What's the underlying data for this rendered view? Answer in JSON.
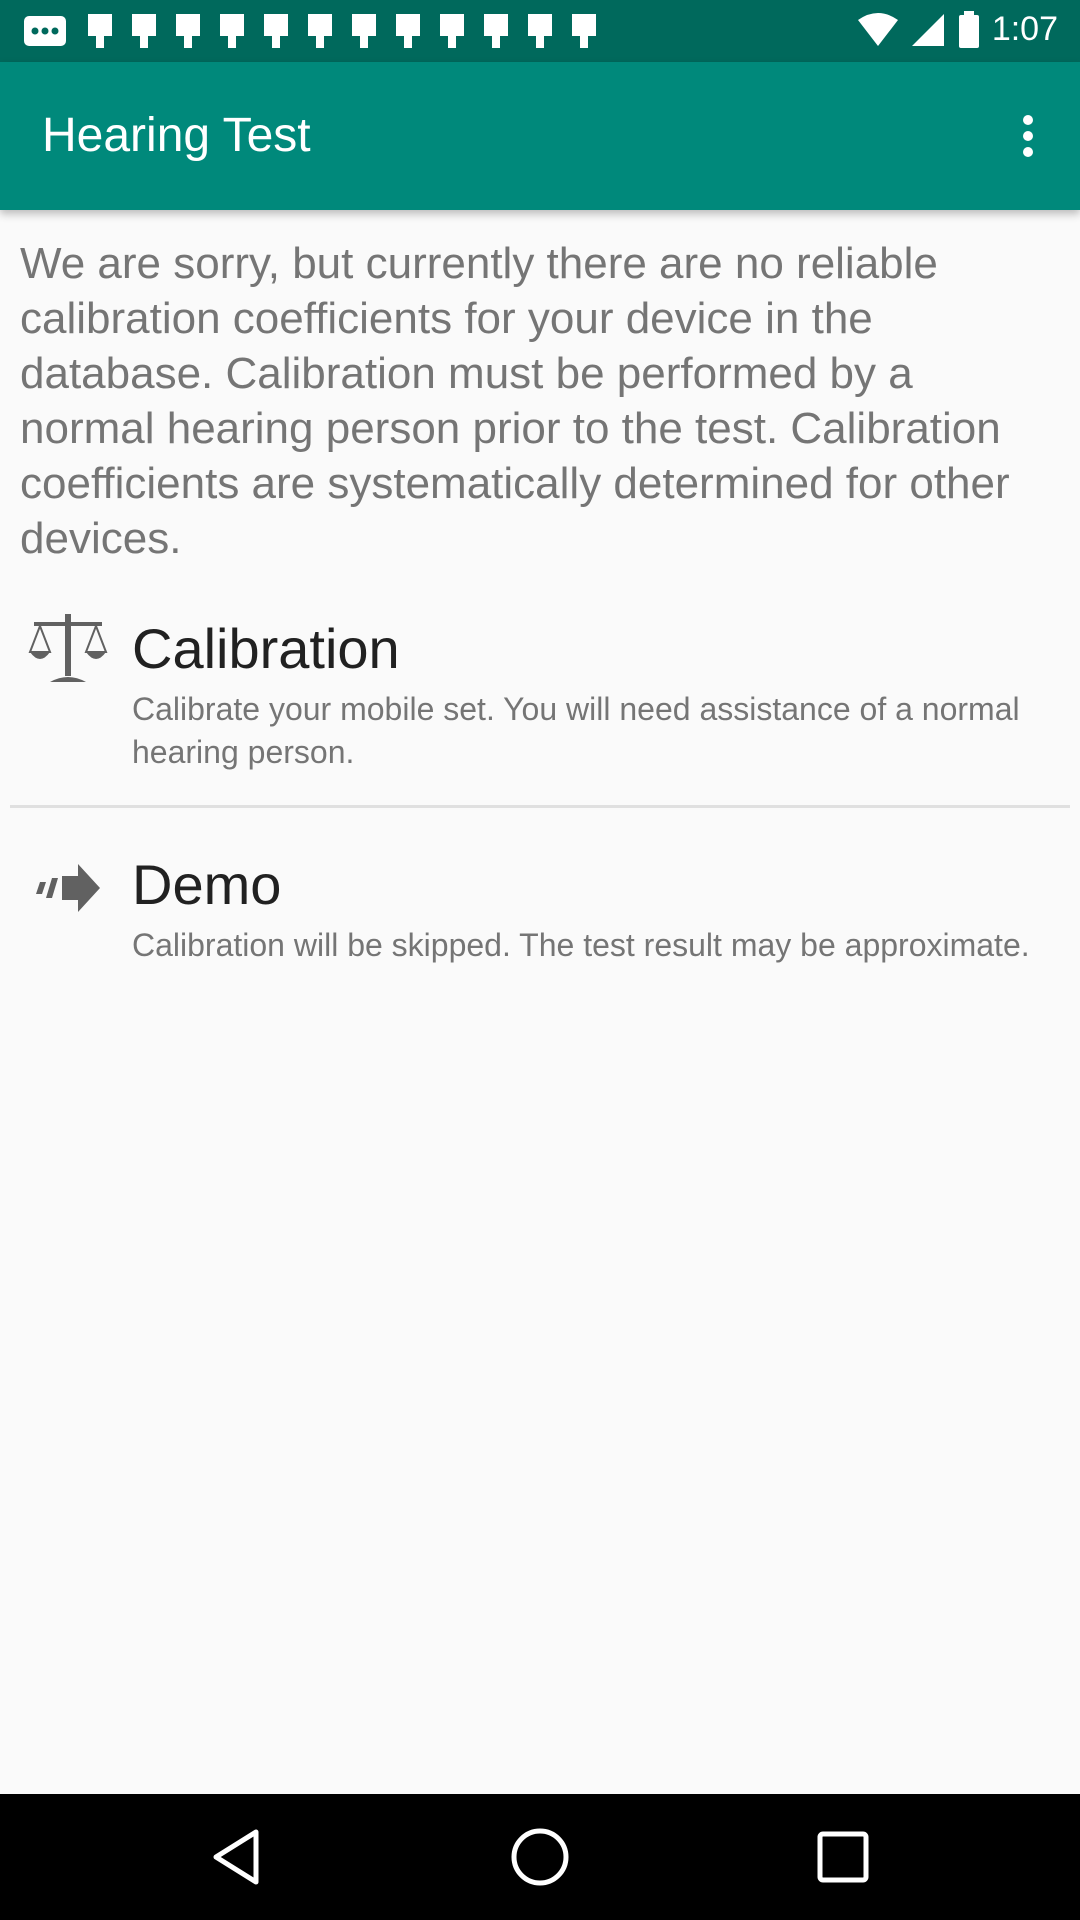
{
  "status_bar": {
    "time": "1:07",
    "notification_icons": [
      "message-icon",
      "notification-icon",
      "notification-icon",
      "notification-icon",
      "notification-icon",
      "notification-icon",
      "notification-icon",
      "notification-icon",
      "notification-icon",
      "notification-icon",
      "notification-icon",
      "notification-icon",
      "notification-icon"
    ],
    "system_icons": [
      "wifi-icon",
      "signal-icon",
      "battery-icon"
    ]
  },
  "app_bar": {
    "title": "Hearing Test",
    "menu_icon": "more-vert-icon",
    "color": "#00897b",
    "status_color": "#00695c"
  },
  "notice": "We are sorry, but currently there are no reliable calibration coefficients for your device in the database. Calibration must be performed by a normal hearing person prior to the test. Calibration coefficients are systematically determined for other devices.",
  "options": [
    {
      "icon": "scale-icon",
      "title": "Calibration",
      "description": "Calibrate your mobile set. You will need assistance of a normal hearing person."
    },
    {
      "icon": "arrow-forward-icon",
      "title": "Demo",
      "description": "Calibration will be skipped. The test result may be approximate."
    }
  ],
  "nav_bar": {
    "buttons": [
      "back-icon",
      "home-icon",
      "recents-icon"
    ]
  }
}
